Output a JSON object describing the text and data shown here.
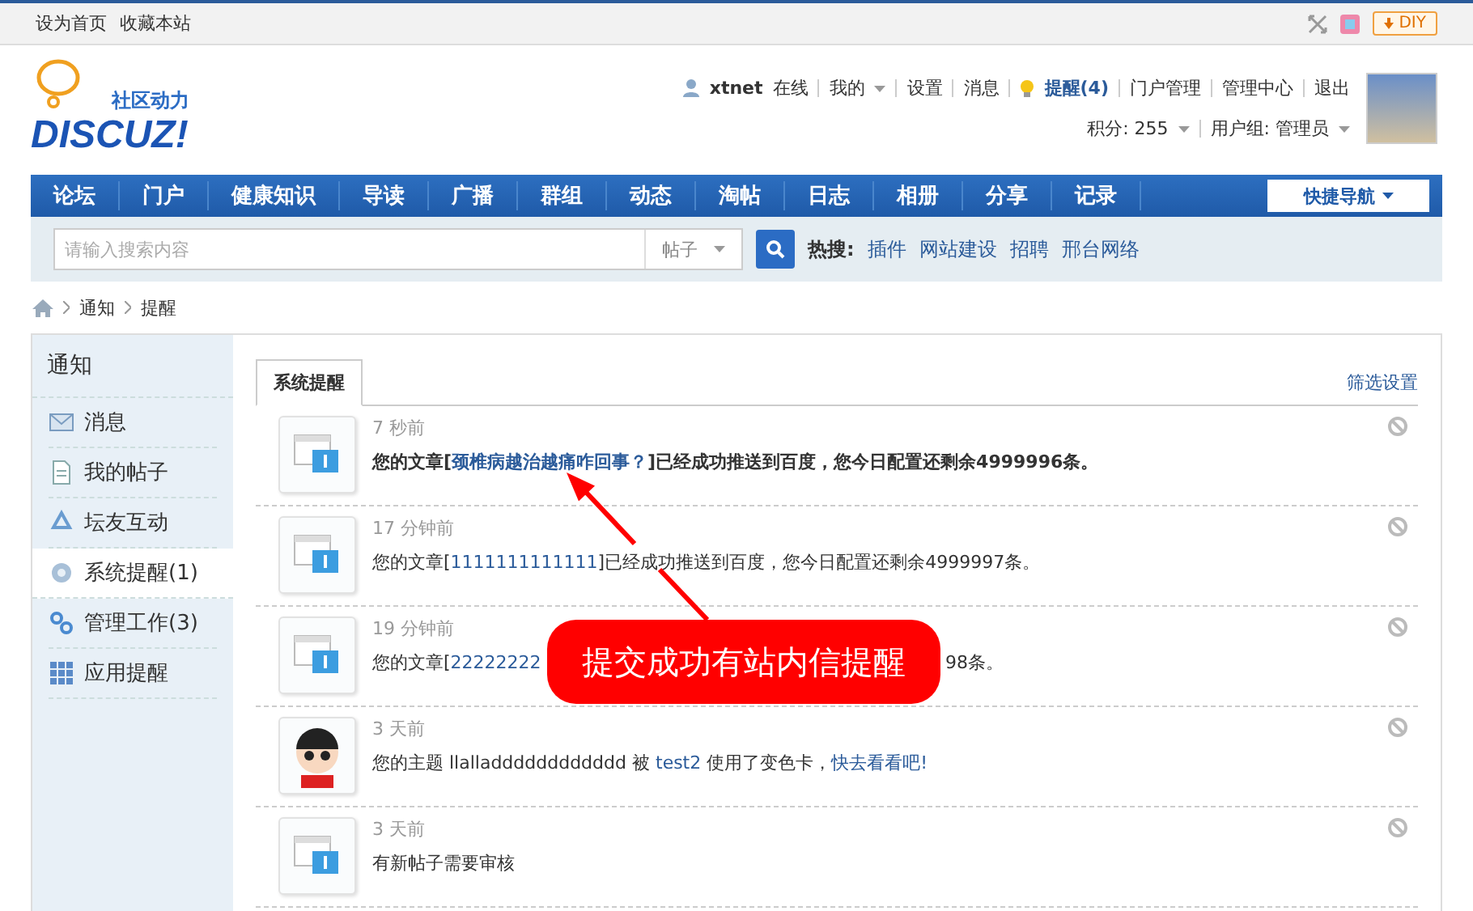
{
  "topbar": {
    "links": [
      "设为首页",
      "收藏本站"
    ],
    "diy": "DIY"
  },
  "logo": {
    "tagline": "社区动力",
    "wordmark": "DISCUZ!"
  },
  "user": {
    "name": "xtnet",
    "status": "在线",
    "menu": [
      "我的",
      "设置",
      "消息"
    ],
    "notice": "提醒(4)",
    "admin": [
      "门户管理",
      "管理中心",
      "退出"
    ],
    "credits": "积分: 255",
    "group": "用户组: 管理员"
  },
  "nav": {
    "items": [
      "论坛",
      "门户",
      "健康知识",
      "导读",
      "广播",
      "群组",
      "动态",
      "淘帖",
      "日志",
      "相册",
      "分享",
      "记录"
    ],
    "quick": "快捷导航"
  },
  "search": {
    "placeholder": "请输入搜索内容",
    "scope": "帖子",
    "hot_label": "热搜:",
    "hot": [
      "插件",
      "网站建设",
      "招聘",
      "邢台网络"
    ]
  },
  "breadcrumb": [
    "通知",
    "提醒"
  ],
  "sidebar": {
    "title": "通知",
    "items": [
      {
        "label": "消息",
        "selected": false
      },
      {
        "label": "我的帖子",
        "selected": false
      },
      {
        "label": "坛友互动",
        "selected": false
      },
      {
        "label": "系统提醒(1)",
        "selected": true
      },
      {
        "label": "管理工作(3)",
        "selected": false
      },
      {
        "label": "应用提醒",
        "selected": false
      }
    ]
  },
  "tabs": [
    {
      "label": "系统提醒",
      "selected": true
    }
  ],
  "filter": "筛选设置",
  "notices": [
    {
      "kind": "system",
      "time": "7 秒前",
      "unread": true,
      "parts": [
        {
          "t": "您的文章[",
          "kind": "text"
        },
        {
          "t": "颈椎病越治越痛咋回事？",
          "kind": "link"
        },
        {
          "t": "]已经成功推送到百度，您今日配置还剩余4999996条。",
          "kind": "text"
        }
      ]
    },
    {
      "kind": "system",
      "time": "17 分钟前",
      "unread": false,
      "parts": [
        {
          "t": "您的文章[",
          "kind": "text"
        },
        {
          "t": "1111111111111",
          "kind": "link"
        },
        {
          "t": "]已经成功推送到百度，您今日配置还剩余4999997条。",
          "kind": "text"
        }
      ]
    },
    {
      "kind": "system",
      "time": "19 分钟前",
      "unread": false,
      "parts": [
        {
          "t": "您的文章[",
          "kind": "text"
        },
        {
          "t": "22222222",
          "kind": "link"
        }
      ],
      "after": [
        {
          "t": "98条。",
          "kind": "text"
        }
      ]
    },
    {
      "kind": "user",
      "time": "3 天前",
      "unread": false,
      "parts": [
        {
          "t": "您的主题 llalladddddddddddd 被 ",
          "kind": "text"
        },
        {
          "t": "test2",
          "kind": "link"
        },
        {
          "t": " 使用了变色卡，",
          "kind": "text"
        },
        {
          "t": "快去看看吧!",
          "kind": "link"
        }
      ]
    },
    {
      "kind": "system",
      "time": "3 天前",
      "unread": false,
      "parts": [
        {
          "t": "有新帖子需要审核",
          "kind": "text"
        }
      ]
    }
  ],
  "callout": {
    "text": "提交成功有站内信提醒"
  }
}
